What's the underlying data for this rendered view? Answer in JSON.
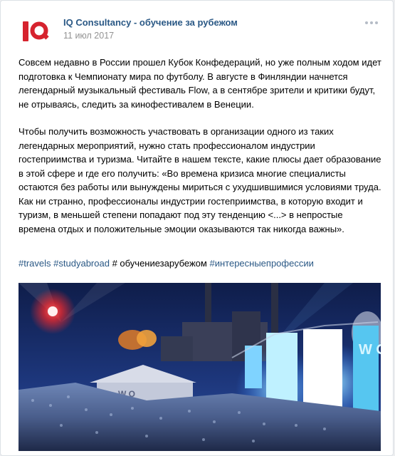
{
  "post": {
    "author": "IQ Consultancy - обучение за рубежом",
    "date": "11 июл 2017",
    "paragraphs": [
      "Совсем недавно в России прошел Кубок Конфедераций, но уже полным ходом идет подготовка к Чемпионату мира по футболу. В августе в Финляндии начнется легендарный музыкальный фестиваль Flow, а в сентябре зрители и критики будут, не отрываясь, следить за кинофестивалем в Венеции.",
      "Чтобы получить возможность участвовать в организации одного из таких легендарных мероприятий, нужно стать профессионалом индустрии гостеприимства и туризма. Читайте в нашем тексте, какие плюсы дает образование в этой сфере и где его получить: «Во времена кризиса многие специалисты остаются без работы или вынуждены мириться с ухудшившимися условиями труда. Как ни странно, профессионалы индустрии гостеприимства, в которую входит и туризм, в меньшей степени попадают под эту тенденцию <...> в непростые времена отдых и положительные эмоции оказываются так никогда важны»."
    ],
    "hashtags": {
      "tag1": "#travels",
      "tag2": "#studyabroad",
      "plain": "# обучениезарубежом",
      "tag3": "#интересныепрофессии"
    },
    "photo_screen_text": "W O",
    "photo_stage_text": "W O"
  },
  "colors": {
    "brand_red": "#d6232e",
    "link_blue": "#2a5885",
    "date_gray": "#939393"
  },
  "icons": {
    "logo": "iq-logo",
    "more": "more-dots-icon"
  }
}
